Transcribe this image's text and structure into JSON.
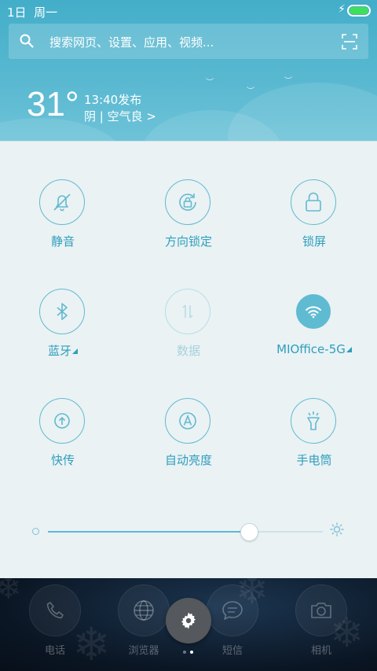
{
  "status_bar": {
    "date": "1日",
    "weekday": "周一",
    "battery_level": 1.0,
    "charging": true
  },
  "search": {
    "placeholder": "搜索网页、设置、应用、视频..."
  },
  "weather": {
    "temperature": "31°",
    "published": "13:40发布",
    "condition": "阴 | 空气良 >"
  },
  "toggles": [
    {
      "label": "静音",
      "icon": "bell-muted-icon",
      "active": false,
      "enabled": true
    },
    {
      "label": "方向锁定",
      "icon": "rotation-lock-icon",
      "active": false,
      "enabled": true
    },
    {
      "label": "锁屏",
      "icon": "lock-icon",
      "active": false,
      "enabled": true
    },
    {
      "label": "蓝牙",
      "icon": "bluetooth-icon",
      "active": false,
      "enabled": true,
      "has_submenu": true
    },
    {
      "label": "数据",
      "icon": "mobile-data-icon",
      "active": false,
      "enabled": false
    },
    {
      "label": "MIOffice-5G",
      "icon": "wifi-icon",
      "active": true,
      "enabled": true,
      "has_submenu": true
    },
    {
      "label": "快传",
      "icon": "quick-transfer-icon",
      "active": false,
      "enabled": true
    },
    {
      "label": "自动亮度",
      "icon": "auto-brightness-icon",
      "active": false,
      "enabled": true
    },
    {
      "label": "手电筒",
      "icon": "flashlight-icon",
      "active": false,
      "enabled": true
    }
  ],
  "brightness": {
    "level": 0.73
  },
  "dock": [
    {
      "label": "电话",
      "icon": "phone-icon"
    },
    {
      "label": "浏览器",
      "icon": "globe-icon"
    },
    {
      "label": "短信",
      "icon": "message-icon"
    },
    {
      "label": "相机",
      "icon": "camera-icon"
    }
  ],
  "settings_button": {
    "icon": "gear-icon"
  },
  "pager": {
    "pages": 2,
    "current": 2
  },
  "colors": {
    "accent": "#2f9ebc",
    "header_bg": "#4fb4cd",
    "panel_bg": "#eaf2f4",
    "battery": "#3ee05a"
  }
}
